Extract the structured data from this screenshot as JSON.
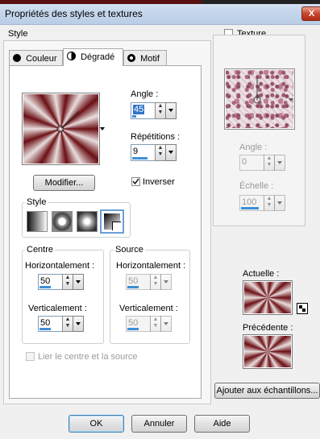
{
  "window": {
    "title": "Propriétés des styles et textures",
    "close_label": "X"
  },
  "style_group": {
    "label": "Style"
  },
  "tabs": [
    {
      "label": "Couleur",
      "icon": "color-circle-icon"
    },
    {
      "label": "Dégradé",
      "icon": "gradient-half-icon"
    },
    {
      "label": "Motif",
      "icon": "pattern-crosshair-icon"
    }
  ],
  "gradient": {
    "edit_button": "Modifier...",
    "angle": {
      "label": "Angle :",
      "value": "45"
    },
    "repetitions": {
      "label": "Répétitions :",
      "value": "9"
    },
    "invert": {
      "label": "Inverser",
      "checked": true
    },
    "style_label": "Style",
    "center": {
      "title": "Centre",
      "horizontal_label": "Horizontalement :",
      "horizontal_value": "50",
      "vertical_label": "Verticalement :",
      "vertical_value": "50"
    },
    "source": {
      "title": "Source",
      "horizontal_label": "Horizontalement :",
      "horizontal_value": "50",
      "vertical_label": "Verticalement :",
      "vertical_value": "50"
    },
    "link_label": "Lier le centre et la source"
  },
  "texture": {
    "label": "Texture",
    "angle_label": "Angle :",
    "angle_value": "0",
    "scale_label": "Échelle :",
    "scale_value": "100"
  },
  "current": {
    "label": "Actuelle :"
  },
  "previous": {
    "label": "Précédente :"
  },
  "add_swatches_button": "Ajouter aux échantillons...",
  "footer": {
    "ok": "OK",
    "cancel": "Annuler",
    "help": "Aide"
  },
  "colors": {
    "accent": "#3c8fd8",
    "gradient_dark": "#6b0f14",
    "gradient_light": "#e9dede"
  }
}
